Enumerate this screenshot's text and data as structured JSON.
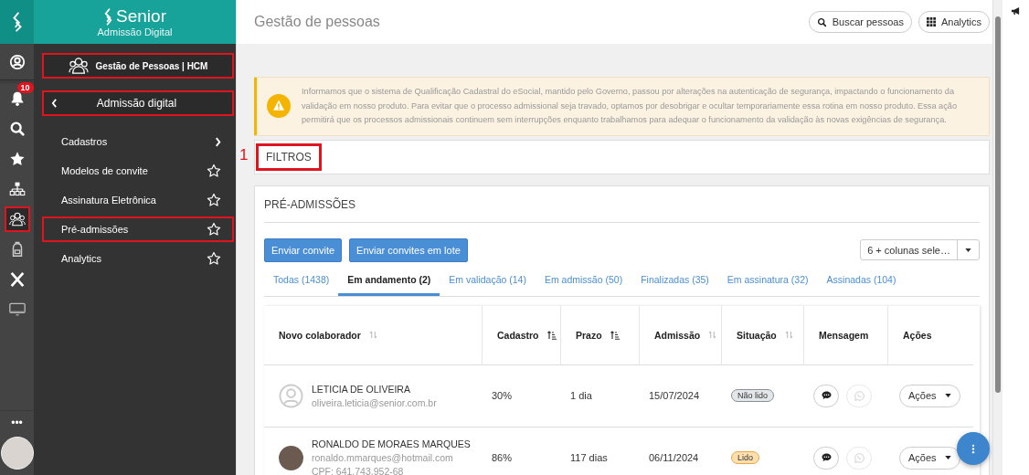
{
  "brand": {
    "name": "Senior",
    "subtitle": "Admissão Digital"
  },
  "rail": {
    "notification_badge": "10",
    "items": [
      {
        "kind": "profile",
        "highlighted": false
      },
      {
        "kind": "notifications",
        "highlighted": false
      },
      {
        "kind": "search",
        "highlighted": false
      },
      {
        "kind": "favorites",
        "highlighted": false
      },
      {
        "kind": "structure",
        "highlighted": false
      },
      {
        "kind": "people",
        "highlighted": true
      },
      {
        "kind": "backpack",
        "highlighted": false
      },
      {
        "kind": "x",
        "highlighted": false
      },
      {
        "kind": "monitor",
        "highlighted": false
      }
    ],
    "more": "•••"
  },
  "menu": {
    "module": {
      "label": "Gestão de Pessoas | HCM",
      "highlighted": true
    },
    "section": {
      "label": "Admissão digital",
      "highlighted": true
    },
    "items": [
      {
        "label": "Cadastros",
        "kind": "submenu",
        "highlighted": false
      },
      {
        "label": "Modelos de convite",
        "kind": "favorite",
        "highlighted": false
      },
      {
        "label": "Assinatura Eletrônica",
        "kind": "favorite",
        "highlighted": false
      },
      {
        "label": "Pré-admissões",
        "kind": "favorite",
        "highlighted": true
      },
      {
        "label": "Analytics",
        "kind": "favorite",
        "highlighted": false
      }
    ]
  },
  "header": {
    "title": "Gestão de pessoas",
    "buttons": [
      {
        "label": "Buscar pessoas",
        "kind": "search"
      },
      {
        "label": "Analytics",
        "kind": "grid"
      }
    ]
  },
  "alert": {
    "text": "Informamos que o sistema de Qualificação Cadastral do eSocial, mantido pelo Governo, passou por alterações na autenticação de segurança, impactando o funcionamento da validação em nosso produto. Para evitar que o processo admissional seja travado, optamos por desobrigar e ocultar temporariamente essa rotina em nosso produto. Essa ação permitirá que os processos admissionais continuem sem interrupções enquanto trabalhamos para adequar o funcionamento da validação às novas exigências de segurança."
  },
  "filters": {
    "step_label": "1",
    "title": "FILTROS",
    "highlighted": true
  },
  "pre_admissions": {
    "title": "PRÉ-ADMISSÕES",
    "buttons": [
      "Enviar convite",
      "Enviar convites em lote"
    ],
    "columns_select": "6 + colunas sele…",
    "tabs": [
      {
        "label": "Todas (1438)",
        "selected": false
      },
      {
        "label": "Em andamento (2)",
        "selected": true
      },
      {
        "label": "Em validação (14)",
        "selected": false
      },
      {
        "label": "Em admissão (50)",
        "selected": false
      },
      {
        "label": "Finalizadas (35)",
        "selected": false
      },
      {
        "label": "Em assinatura (32)",
        "selected": false
      },
      {
        "label": "Assinadas (104)",
        "selected": false
      }
    ],
    "columns": [
      {
        "label": "Novo colaborador",
        "kind": "sortable"
      },
      {
        "label": "Cadastro",
        "kind": "sorted"
      },
      {
        "label": "Prazo",
        "kind": "sorted"
      },
      {
        "label": "Admissão",
        "kind": "sortable"
      },
      {
        "label": "Situação",
        "kind": "sortable"
      },
      {
        "label": "Mensagem",
        "kind": "plain"
      },
      {
        "label": "Ações",
        "kind": "plain"
      }
    ],
    "rows": [
      {
        "kind": "placeholder",
        "name": "LETICIA DE OLIVEIRA",
        "email": "oliveira.leticia@senior.com.br",
        "cadastro": "30%",
        "prazo": "1 dia",
        "admissao": "15/07/2024",
        "status": {
          "label": "Não lido",
          "kind": "unread"
        },
        "whatsapp_disabled": true,
        "actions": "Ações"
      },
      {
        "kind": "photo",
        "name": "RONALDO DE MORAES MARQUES",
        "email": "ronaldo.mmarques@hotmail.com",
        "cpf": "CPF: 641.743.952-68",
        "cadastro": "86%",
        "prazo": "117 dias",
        "admissao": "06/11/2024",
        "status": {
          "label": "Lido",
          "kind": "read"
        },
        "whatsapp_disabled": true,
        "actions": "Ações"
      }
    ]
  }
}
